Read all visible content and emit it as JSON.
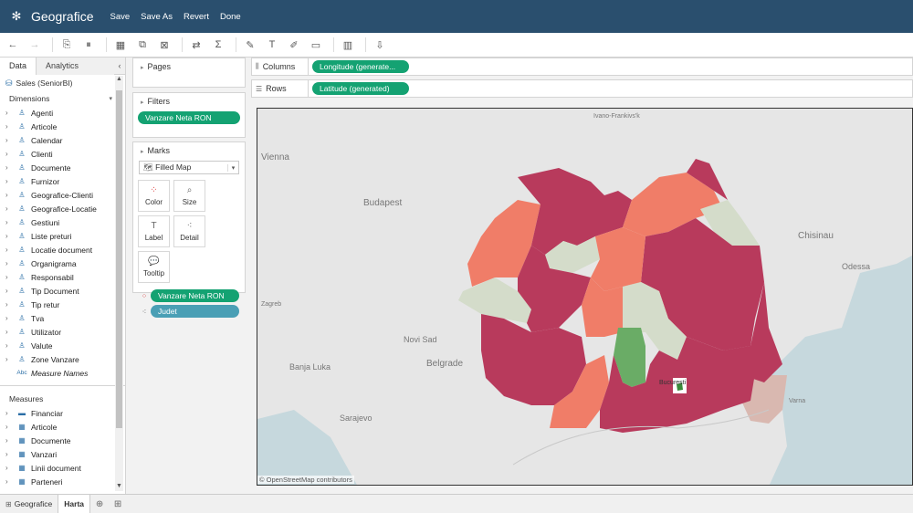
{
  "app": {
    "title": "Geografice",
    "actions": [
      "Save",
      "Save As",
      "Revert",
      "Done"
    ]
  },
  "toolbar": {
    "icons": [
      "back-icon",
      "forward-icon",
      "new-datasource-icon",
      "pause-icon",
      "new-sheet-icon",
      "duplicate-icon",
      "clear-icon",
      "swap-icon",
      "totals-icon",
      "highlight-icon",
      "text-icon",
      "annotate-icon",
      "fit-icon",
      "show-me-icon",
      "present-icon"
    ]
  },
  "data_pane": {
    "tabs": [
      "Data",
      "Analytics"
    ],
    "collapse": "‹",
    "datasource": "Sales (SeniorBI)",
    "dimensions_label": "Dimensions",
    "dimensions": [
      "Agenti",
      "Articole",
      "Calendar",
      "Clienti",
      "Documente",
      "Furnizor",
      "Geografice-Clienti",
      "Geografice-Locatie",
      "Gestiuni",
      "Liste preturi",
      "Locatie document",
      "Organigrama",
      "Responsabil",
      "Tip Document",
      "Tip retur",
      "Tva",
      "Utilizator",
      "Valute",
      "Zone Vanzare",
      "Measure Names"
    ],
    "measures_label": "Measures",
    "measures": [
      "Financiar",
      "Articole",
      "Documente",
      "Vanzari",
      "Linii document",
      "Parteneri"
    ]
  },
  "cards": {
    "pages_label": "Pages",
    "filters_label": "Filters",
    "filter_pill": "Vanzare Neta RON",
    "marks_label": "Marks",
    "mark_type": "Filled Map",
    "mark_buttons": [
      "Color",
      "Size",
      "Label",
      "Detail",
      "Tooltip"
    ],
    "mark_pills": [
      "Vanzare Neta RON",
      "Judet"
    ]
  },
  "shelves": {
    "columns_label": "Columns",
    "columns_pill": "Longitude (generate...",
    "rows_label": "Rows",
    "rows_pill": "Latitude (generated)"
  },
  "map": {
    "labels": [
      "Vienna",
      "Budapest",
      "Chisinau",
      "Odessa",
      "Novi Sad",
      "Belgrade",
      "Banja Luka",
      "Sarajevo",
      "Ivano-Frankivs'k",
      "Bucuresti",
      "Varna",
      "Zagreb"
    ],
    "attribution": "© OpenStreetMap contributors",
    "colors": {
      "high": "#b83a5c",
      "mid": "#f07d68",
      "low": "#d4dcca",
      "top": "#6aac66",
      "sea": "#c6d8dd",
      "bulgaria_tint": "#d9b8b0"
    }
  },
  "sheet_tabs": [
    "Geografice",
    "Harta"
  ]
}
